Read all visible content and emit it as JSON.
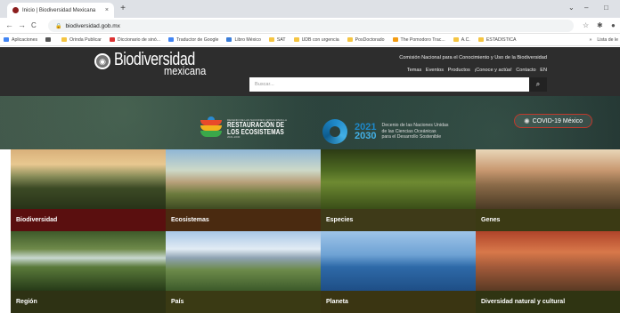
{
  "browser": {
    "tab_title": "Inicio | Biodiversidad Mexicana",
    "tab_close": "×",
    "new_tab": "+",
    "url": "biodiversidad.gob.mx",
    "nav_back": "←",
    "nav_forward": "→",
    "nav_reload": "C",
    "win_chevron": "⌄",
    "win_min": "–",
    "win_max": "□",
    "bookmarks": [
      {
        "label": "Aplicaciones",
        "color": "#4285f4"
      },
      {
        "label": "",
        "color": "#555555"
      },
      {
        "label": "Orinda Publicar",
        "color": "#f5c542"
      },
      {
        "label": "Diccionario de sinó...",
        "color": "#d33"
      },
      {
        "label": "Traductor de Google",
        "color": "#4285f4"
      },
      {
        "label": "Libro México",
        "color": "#3b7dd8"
      },
      {
        "label": "SAT",
        "color": "#f5c542"
      },
      {
        "label": "UDB con urgencia",
        "color": "#f5c542"
      },
      {
        "label": "PosDoctorado",
        "color": "#f5c542"
      },
      {
        "label": "The Pomodoro Trac...",
        "color": "#f39c12"
      },
      {
        "label": "A.C.",
        "color": "#f5c542"
      },
      {
        "label": "ESTADISTICA",
        "color": "#f5c542"
      }
    ],
    "bookmarks_more": "»",
    "reading_list": "Lista de le"
  },
  "site": {
    "logo_line1": "Biodiversidad",
    "logo_line2": "mexicana",
    "conabio": "Comisión Nacional para el Conocimiento y Uso de la Biodiversidad",
    "menu": [
      "Temas",
      "Eventos",
      "Productos",
      "¡Conoce y actúa!",
      "Contacto",
      "EN"
    ],
    "search_placeholder": "Buscar...",
    "search_icon": "search-icon"
  },
  "banner": {
    "restauracion_small": "DECENIO DE LAS NACIONES UNIDAS PARA LA",
    "restauracion_big1": "RESTAURACIÓN DE",
    "restauracion_big2": "LOS ECOSISTEMAS",
    "restauracion_years": "2021-2030",
    "decade_year1": "2021",
    "decade_year2": "2030",
    "decade_text1": "Decenio de las Naciones Unidas",
    "decade_text2": "de las Ciencias Oceánicas",
    "decade_text3": "para el Desarrollo Sostenible",
    "covid_label": "COVID-19 México"
  },
  "tiles": [
    {
      "label": "Biodiversidad",
      "color": "#5a0f0f"
    },
    {
      "label": "Ecosistemas",
      "color": "#4a2a10"
    },
    {
      "label": "Especies",
      "color": "#3e3a18"
    },
    {
      "label": "Genes",
      "color": "#3b3a14"
    },
    {
      "label": "Región",
      "color": "#2e3214"
    },
    {
      "label": "País",
      "color": "#3a3a14"
    },
    {
      "label": "Planeta",
      "color": "#3a3512"
    },
    {
      "label": "Diversidad natural y cultural",
      "color": "#2f3412"
    }
  ]
}
